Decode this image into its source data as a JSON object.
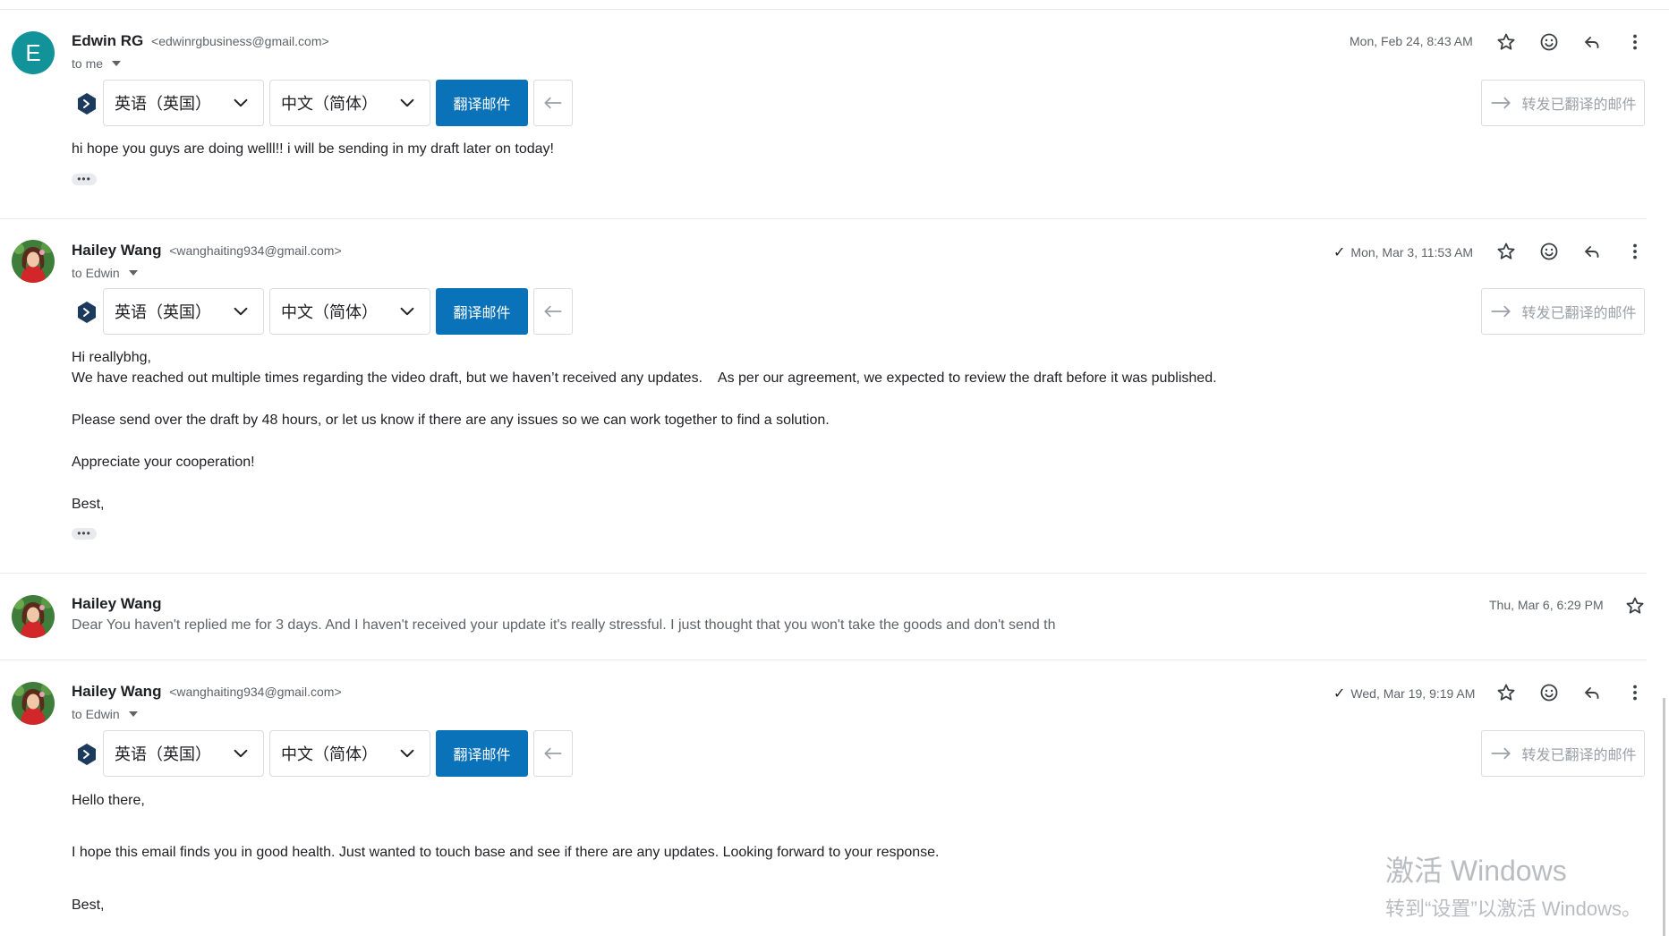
{
  "messages": [
    {
      "avatar_letter": "E",
      "sender_name": "Edwin RG",
      "sender_email": "<edwinrgbusiness@gmail.com>",
      "recipient": "to me",
      "date": "Mon, Feb 24, 8:43 AM",
      "body": [
        "hi hope you guys are doing welll!! i will be sending in my draft later on today!"
      ]
    },
    {
      "sender_name": "Hailey Wang",
      "sender_email": "<wanghaiting934@gmail.com>",
      "recipient": "to Edwin",
      "check": "✓",
      "date": "Mon, Mar 3, 11:53 AM",
      "body": [
        "Hi reallybhg,",
        "We have reached out multiple times regarding the video draft, but we haven’t received any updates.    As per our agreement, we expected to review the draft before it was published.",
        "Please send over the draft by 48 hours, or let us know if there are any issues so we can work together to find a solution.",
        "Appreciate your cooperation!",
        "Best,"
      ]
    },
    {
      "sender_name": "Hailey Wang",
      "date": "Thu, Mar 6, 6:29 PM",
      "snippet": "Dear You haven't replied me for 3 days. And I haven't received your update it's really stressful. I just thought that you won't take the goods and don't send th"
    },
    {
      "sender_name": "Hailey Wang",
      "sender_email": "<wanghaiting934@gmail.com>",
      "recipient": "to Edwin",
      "check": "✓",
      "date": "Wed, Mar 19, 9:19 AM",
      "body": [
        "Hello there,",
        "I hope this email finds you in good health. Just wanted to touch base and see if there are any updates. Looking forward to your response.",
        "Best,"
      ]
    }
  ],
  "translate": {
    "source_lang": "英语（英国）",
    "target_lang": "中文（简体）",
    "translate_button": "翻译邮件",
    "forward_button": "转发已翻译的邮件"
  },
  "more_dots": "•••",
  "watermark": {
    "line1": "激活 Windows",
    "line2": "转到“设置”以激活 Windows。"
  },
  "colors": {
    "accent": "#0a72b8",
    "avatar_e": "#12939a",
    "logo": "#1b3a5c"
  },
  "icons": [
    "star-icon",
    "emoji-icon",
    "reply-icon",
    "more-vert-icon",
    "chevron-down-icon",
    "arrow-left-icon",
    "arrow-right-icon",
    "translator-logo-icon"
  ]
}
